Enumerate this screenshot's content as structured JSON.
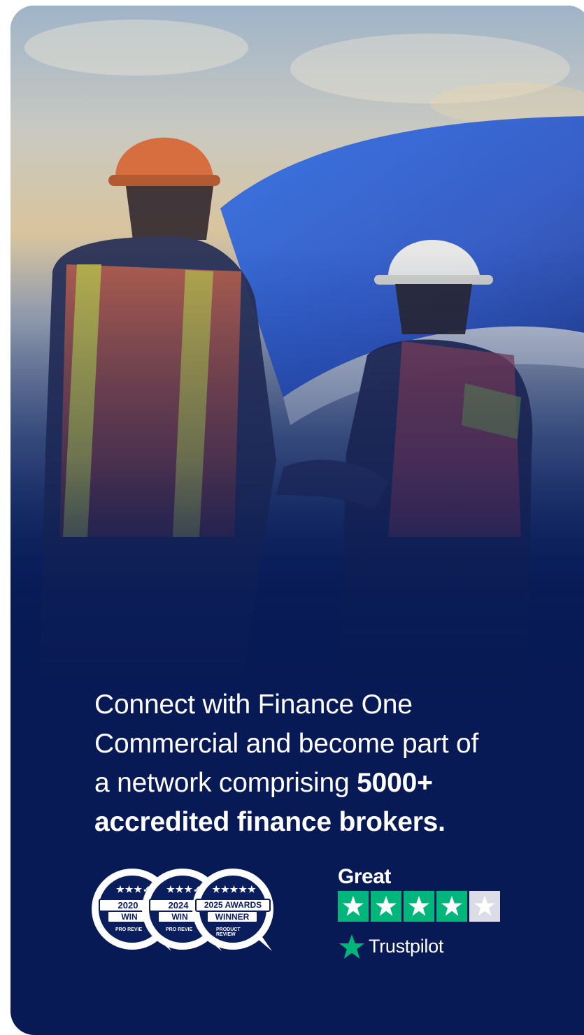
{
  "promo": {
    "line1": "Connect with Finance One",
    "line2": "Commercial and become part of",
    "line3_start": "a network comprising ",
    "line3_bold": "5000+",
    "line4_bold": "accredited finance brokers."
  },
  "awards": {
    "badges": [
      {
        "year": "2020",
        "label": "WIN",
        "stars": "★★★✓",
        "source": "PRO REVIE"
      },
      {
        "year": "2024",
        "label": "WIN",
        "stars": "★★★✓",
        "source": "PRO REVIE"
      },
      {
        "year": "2025 AWARDS",
        "label": "WINNER",
        "stars": "★★★★★",
        "source": "PRODUCT REVIEW"
      }
    ]
  },
  "trustpilot": {
    "rating_label": "Great",
    "stars_filled": 4,
    "stars_total": 5,
    "brand": "Trustpilot",
    "star_color": "#00b67a",
    "empty_star_color": "#dcdce6"
  },
  "colors": {
    "navy": "#071a55",
    "accent_blue": "#1f5bd6"
  }
}
